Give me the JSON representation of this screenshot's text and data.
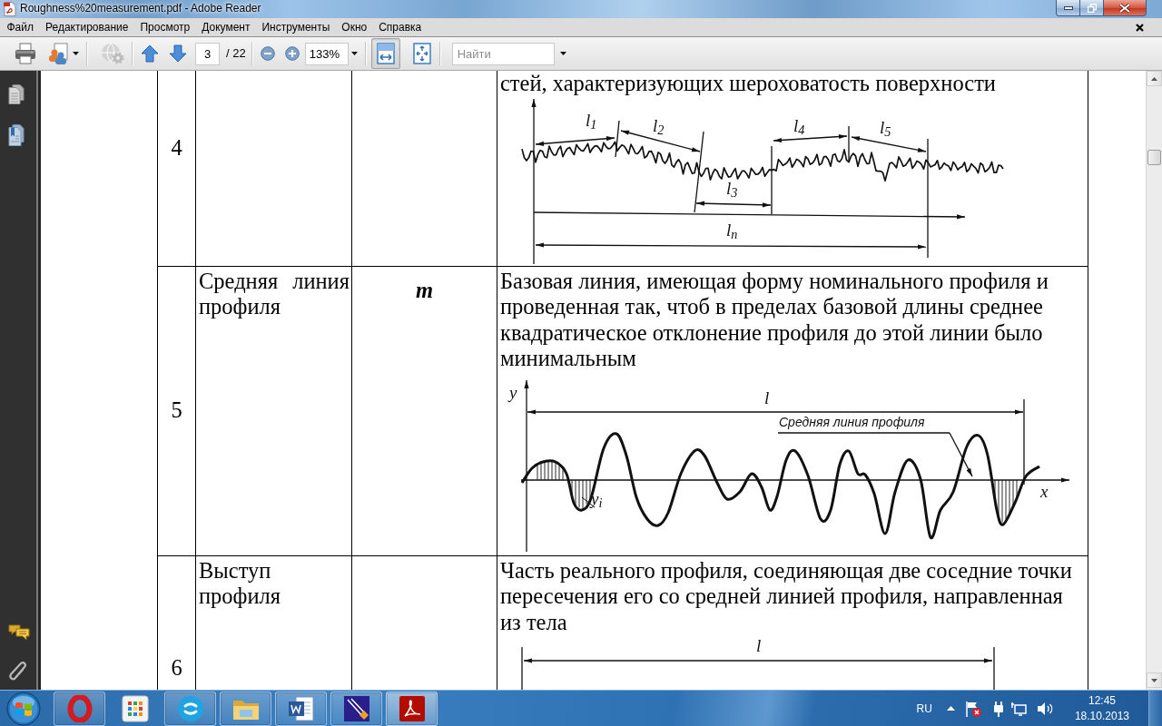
{
  "window": {
    "title": "Roughness%20measurement.pdf - Adobe Reader"
  },
  "menu": [
    "Файл",
    "Редактирование",
    "Просмотр",
    "Документ",
    "Инструменты",
    "Окно",
    "Справка"
  ],
  "toolbar": {
    "file_buttons": [
      {
        "kind": "print",
        "disabled": false,
        "dropdown": false
      },
      {
        "kind": "share",
        "disabled": false,
        "dropdown": true
      },
      {
        "kind": "collaborate",
        "disabled": true,
        "dropdown": false
      }
    ],
    "page_number": "3",
    "page_count": "/ 22",
    "zoom": "133%",
    "view_buttons": [
      {
        "kind": "fit_width",
        "selected": true
      },
      {
        "kind": "fit_page",
        "selected": false
      }
    ],
    "search": {
      "placeholder": "Найти"
    }
  },
  "document": {
    "rows": [
      {
        "number": "4",
        "definition": "стей, характеризующих шероховатость поверхности",
        "figure": {
          "kind": "sampling_lengths",
          "labels": [
            "l$_{1}$",
            "l$_{2}$",
            "l$_{3}$",
            "l$_{4}$",
            "l$_{5}$",
            "l$_{n}$"
          ]
        }
      },
      {
        "number": "5",
        "term": "Средняя линия профиля",
        "symbol": "m",
        "definition": "Базовая линия, имеющая форму номинального профиля и проведенная так, чтоб в пределах базовой длины среднее квадратическое отклонение профиля до этой линии было минимальным",
        "figure": {
          "kind": "mean_line",
          "labels": [
            "y",
            "l",
            "Средняя линия профиля",
            "x",
            "y$_{i}$"
          ]
        }
      },
      {
        "number": "6",
        "term": "Выступ\nпрофиля",
        "definition": "Часть реального профиля, соединяющая две соседние точки пересечения его со средней линией профиля, направленная из тела",
        "figure": {
          "kind": "profile_peak",
          "labels": [
            "l"
          ]
        }
      }
    ]
  },
  "taskbar": {
    "apps": [
      {
        "kind": "ring_logo",
        "running": true,
        "selected": false
      },
      {
        "kind": "app_grid",
        "running": false,
        "selected": false
      },
      {
        "kind": "bubble_logo",
        "running": true,
        "selected": false
      },
      {
        "kind": "folder",
        "running": true,
        "selected": false
      },
      {
        "kind": "word_document",
        "running": true,
        "selected": false
      },
      {
        "kind": "pen_tile",
        "running": true,
        "selected": false
      },
      {
        "kind": "pdf_reader",
        "running": true,
        "selected": true
      }
    ],
    "language": "RU",
    "clock": {
      "time": "12:45",
      "date": "18.10.2013"
    }
  }
}
